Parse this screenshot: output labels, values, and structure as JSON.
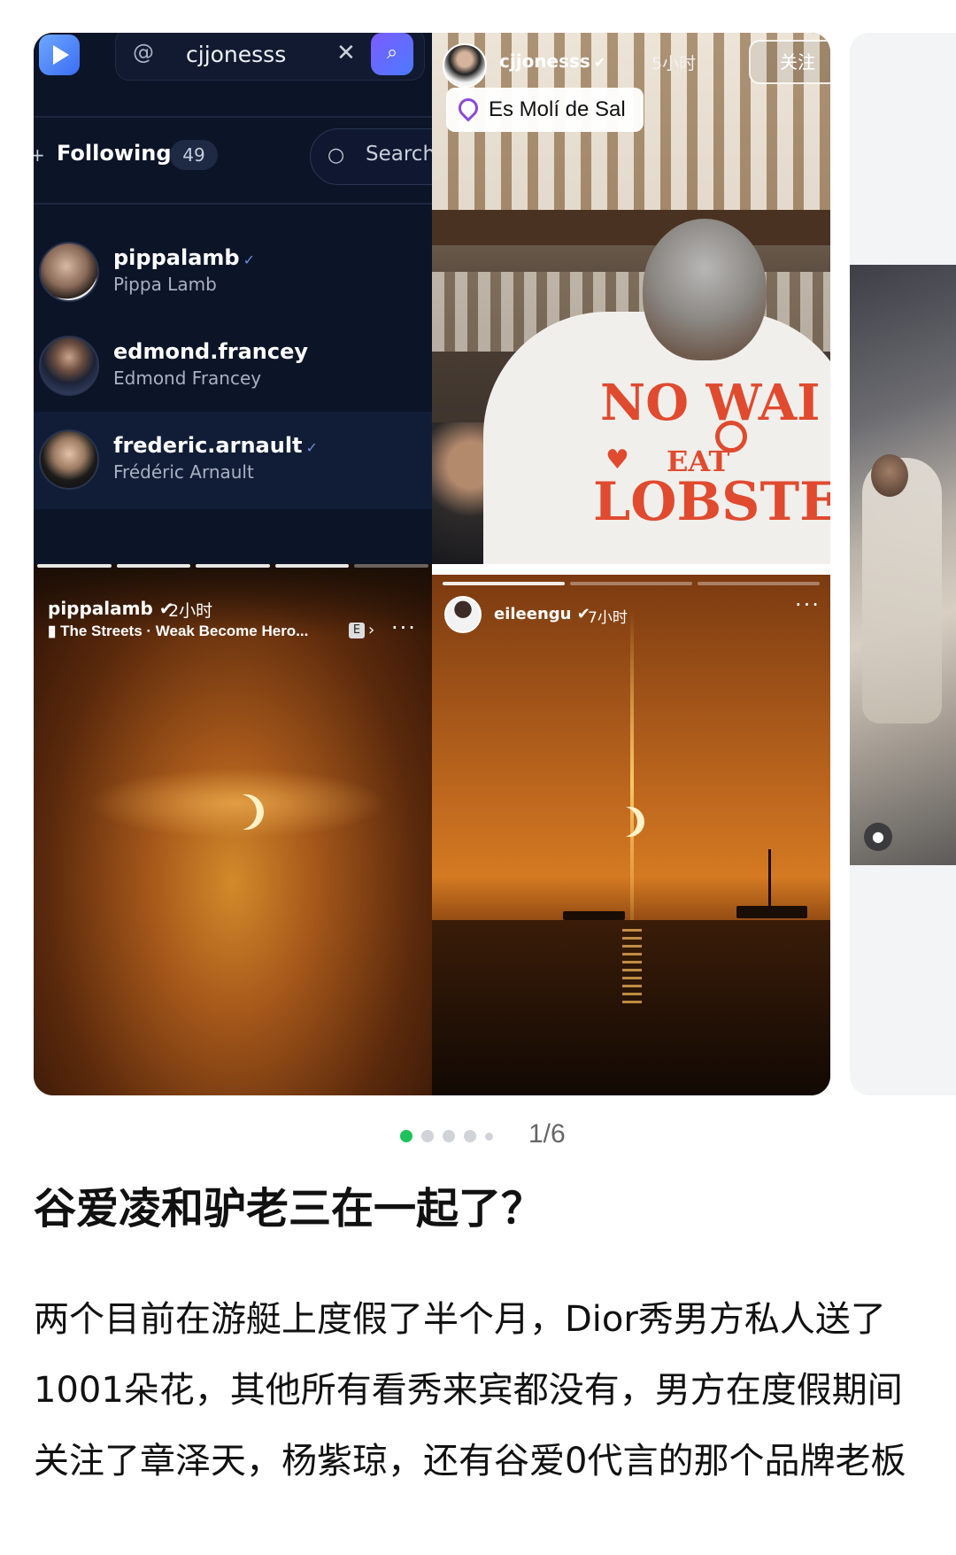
{
  "follow_list_panel": {
    "search_value": "cjjonesss",
    "following_label": "Following",
    "following_count": "49",
    "search_placeholder": "Search",
    "users": [
      {
        "handle": "pippalamb",
        "name": "Pippa Lamb",
        "verified": true
      },
      {
        "handle": "edmond.francey",
        "name": "Edmond Francey",
        "verified": false
      },
      {
        "handle": "frederic.arnault",
        "name": "Frédéric Arnault",
        "verified": true
      }
    ]
  },
  "photo_panel": {
    "username": "cjjonesss",
    "time": "5小时",
    "follow_label": "关注",
    "location": "Es Molí de Sal",
    "shirt_line1": "NO WAI",
    "shirt_line2": "EAT",
    "shirt_line3": "LOBSTE"
  },
  "story_left": {
    "username": "pippalamb",
    "time": "2小时",
    "music": "The Streets · Weak Become Hero...",
    "explicit": "E",
    "more": "···"
  },
  "story_right": {
    "username": "eileengu",
    "time": "7小时",
    "more": "···"
  },
  "pager": {
    "counter": "1/6",
    "active_index": 0,
    "total_dots": 5
  },
  "post": {
    "title": "谷爱凌和驴老三在一起了？",
    "body": "两个目前在游艇上度假了半个月，Dior秀男方私人送了1001朵花，其他所有看秀来宾都没有，男方在度假期间关注了章泽天，杨紫琼，还有谷爱0代言的那个品牌老板"
  },
  "colors": {
    "accent_green": "#1ec25a",
    "dark_panel": "#0c1427",
    "shirt_red": "#e04a2f"
  }
}
